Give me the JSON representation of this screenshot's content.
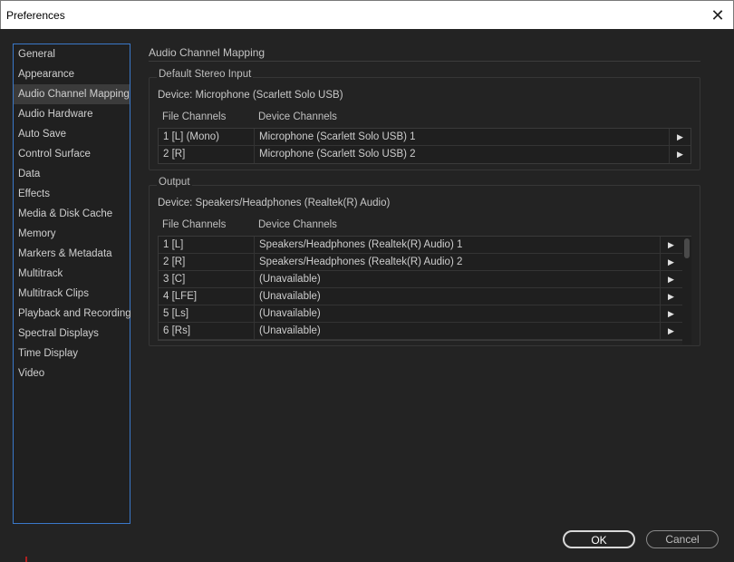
{
  "window": {
    "title": "Preferences",
    "close_glyph": "✕"
  },
  "sidebar": {
    "selected_index": 2,
    "items": [
      {
        "label": "General"
      },
      {
        "label": "Appearance"
      },
      {
        "label": "Audio Channel Mapping"
      },
      {
        "label": "Audio Hardware"
      },
      {
        "label": "Auto Save"
      },
      {
        "label": "Control Surface"
      },
      {
        "label": "Data"
      },
      {
        "label": "Effects"
      },
      {
        "label": "Media & Disk Cache"
      },
      {
        "label": "Memory"
      },
      {
        "label": "Markers & Metadata"
      },
      {
        "label": "Multitrack"
      },
      {
        "label": "Multitrack Clips"
      },
      {
        "label": "Playback and Recording"
      },
      {
        "label": "Spectral Displays"
      },
      {
        "label": "Time Display"
      },
      {
        "label": "Video"
      }
    ]
  },
  "main": {
    "section_title": "Audio Channel Mapping",
    "stereo_input": {
      "group_label": "Default Stereo Input",
      "device": "Device: Microphone (Scarlett Solo USB)",
      "headers": {
        "file": "File Channels",
        "device": "Device Channels"
      },
      "rows": [
        {
          "file": "1 [L] (Mono)",
          "device": "Microphone (Scarlett Solo USB) 1"
        },
        {
          "file": "2 [R]",
          "device": "Microphone (Scarlett Solo USB) 2"
        }
      ]
    },
    "output": {
      "group_label": "Output",
      "device": "Device: Speakers/Headphones (Realtek(R) Audio)",
      "headers": {
        "file": "File Channels",
        "device": "Device Channels"
      },
      "rows": [
        {
          "file": "1 [L]",
          "device": "Speakers/Headphones (Realtek(R) Audio) 1"
        },
        {
          "file": "2 [R]",
          "device": "Speakers/Headphones (Realtek(R) Audio) 2"
        },
        {
          "file": "3 [C]",
          "device": "(Unavailable)"
        },
        {
          "file": "4 [LFE]",
          "device": "(Unavailable)"
        },
        {
          "file": "5 [Ls]",
          "device": "(Unavailable)"
        },
        {
          "file": "6 [Rs]",
          "device": "(Unavailable)"
        }
      ]
    }
  },
  "buttons": {
    "ok": "OK",
    "cancel": "Cancel"
  },
  "icons": {
    "row_arrow": "chevron-right-icon",
    "close": "close-icon"
  },
  "colors": {
    "background": "#232323",
    "sidebar_border": "#3a78c9",
    "selected_item": "#3b3b3b"
  }
}
